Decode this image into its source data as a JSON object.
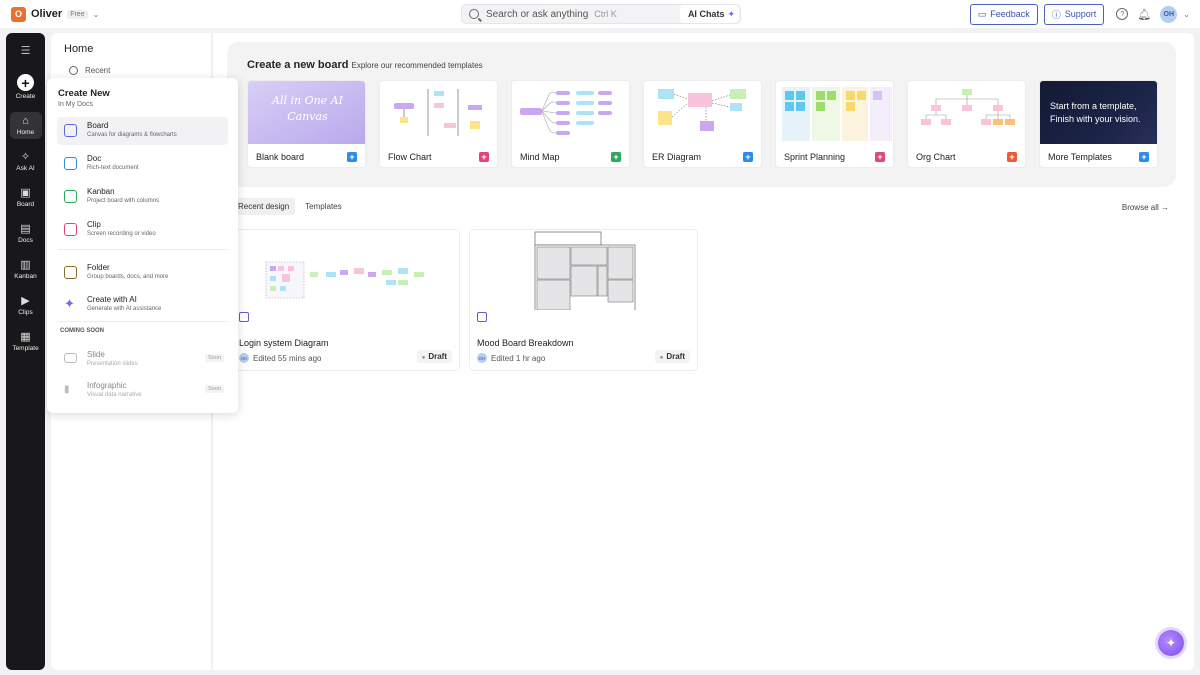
{
  "workspace": {
    "initial": "O",
    "name": "Oliver",
    "plan": "Free"
  },
  "search": {
    "placeholder": "Search or ask anything",
    "shortcut": "Ctrl K",
    "ai_chats_label": "AI Chats"
  },
  "top_actions": {
    "feedback": "Feedback",
    "support": "Support",
    "avatar_initials": "OH"
  },
  "nav": {
    "items": [
      {
        "label": "Create"
      },
      {
        "label": "Home"
      },
      {
        "label": "Ask AI"
      },
      {
        "label": "Board"
      },
      {
        "label": "Docs"
      },
      {
        "label": "Kanban"
      },
      {
        "label": "Clips"
      },
      {
        "label": "Template"
      }
    ]
  },
  "home_panel": {
    "title": "Home",
    "recent": "Recent"
  },
  "hero": {
    "title": "Create a new board",
    "subtitle": "Explore our recommended templates",
    "ai_canvas_text": "All in One AI Canvas",
    "more_text": "Start from a template, Finish with your vision.",
    "templates": [
      {
        "label": "Blank board",
        "accent": "#2d8ae8"
      },
      {
        "label": "Flow Chart",
        "accent": "#e0457b"
      },
      {
        "label": "Mind Map",
        "accent": "#2ea85a"
      },
      {
        "label": "ER Diagram",
        "accent": "#2d8ae8"
      },
      {
        "label": "Sprint Planning",
        "accent": "#e0457b"
      },
      {
        "label": "Org Chart",
        "accent": "#ea5a36"
      },
      {
        "label": "More Templates",
        "accent": "#2d8ae8"
      }
    ]
  },
  "tabs": [
    {
      "label": "Recent design"
    },
    {
      "label": "Templates"
    }
  ],
  "browse_all": "Browse all",
  "recent_designs": [
    {
      "title": "Login system Diagram",
      "avatar": "OH",
      "edited": "Edited 55 mins ago",
      "status": "Draft"
    },
    {
      "title": "Mood Board Breakdown",
      "avatar": "OH",
      "edited": "Edited 1 hr ago",
      "status": "Draft"
    }
  ],
  "create_menu": {
    "title": "Create New",
    "subtitle": "In My Docs",
    "items": [
      {
        "name": "Board",
        "desc": "Canvas for diagrams & flowcharts",
        "color": "#5b6bd6"
      },
      {
        "name": "Doc",
        "desc": "Rich-text document",
        "color": "#2f8fd0"
      },
      {
        "name": "Kanban",
        "desc": "Project board with columns",
        "color": "#2ea85a"
      },
      {
        "name": "Clip",
        "desc": "Screen recording or video",
        "color": "#e0457b"
      },
      {
        "name": "Folder",
        "desc": "Group boards, docs, and more",
        "color": "#8a6a2a"
      },
      {
        "name": "Create with AI",
        "desc": "Generate with AI assistance",
        "color": "#8b5cf6"
      }
    ],
    "coming_soon_label": "COMING SOON",
    "coming_soon": [
      {
        "name": "Slide",
        "desc": "Presentation slides",
        "badge": "Soon"
      },
      {
        "name": "Infographic",
        "desc": "Visual data narrative",
        "badge": "Soon"
      }
    ]
  }
}
